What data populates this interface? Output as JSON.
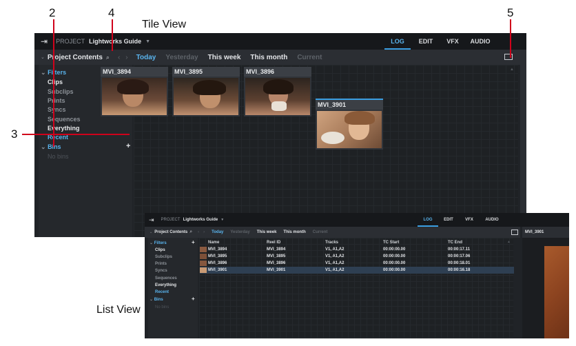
{
  "annotations": {
    "callouts": [
      "2",
      "4",
      "5",
      "3"
    ],
    "tile_view_label": "Tile View",
    "list_view_label": "List View"
  },
  "app": {
    "project_label": "PROJECT",
    "project_name": "Lightworks Guide",
    "tabs": [
      "LOG",
      "EDIT",
      "VFX",
      "AUDIO"
    ],
    "active_tab": "LOG",
    "sidebar": {
      "header": "Project Contents",
      "filters_label": "Filters",
      "filters": [
        "Clips",
        "Subclips",
        "Prints",
        "Syncs",
        "Sequences",
        "Everything",
        "Recent"
      ],
      "bins_label": "Bins",
      "no_bins": "No bins"
    },
    "date_filters": [
      "Today",
      "Yesterday",
      "This week",
      "This month",
      "Current"
    ]
  },
  "tile_view": {
    "tiles": [
      "MVI_3894",
      "MVI_3895",
      "MVI_3896",
      "MVI_3901"
    ]
  },
  "list_view": {
    "columns": [
      "Name",
      "Reel ID",
      "Tracks",
      "TC Start",
      "TC End"
    ],
    "rows": [
      [
        "MVI_3894",
        "MVI_3894",
        "V1, A1,A2",
        "00:00:00.00",
        "00:00:17.11"
      ],
      [
        "MVI_3895",
        "MVI_3895",
        "V1, A1,A2",
        "00:00:00.00",
        "00:00:17.06"
      ],
      [
        "MVI_3896",
        "MVI_3896",
        "V1, A1,A2",
        "00:00:00.00",
        "00:00:18.01"
      ],
      [
        "MVI_3901",
        "MVI_3901",
        "V1, A1,A2",
        "00:00:00.00",
        "00:00:16.18"
      ]
    ],
    "viewer_title": "MVI_3901"
  },
  "colors": {
    "accent": "#5ab5ef",
    "callout_line": "#d0021b"
  }
}
